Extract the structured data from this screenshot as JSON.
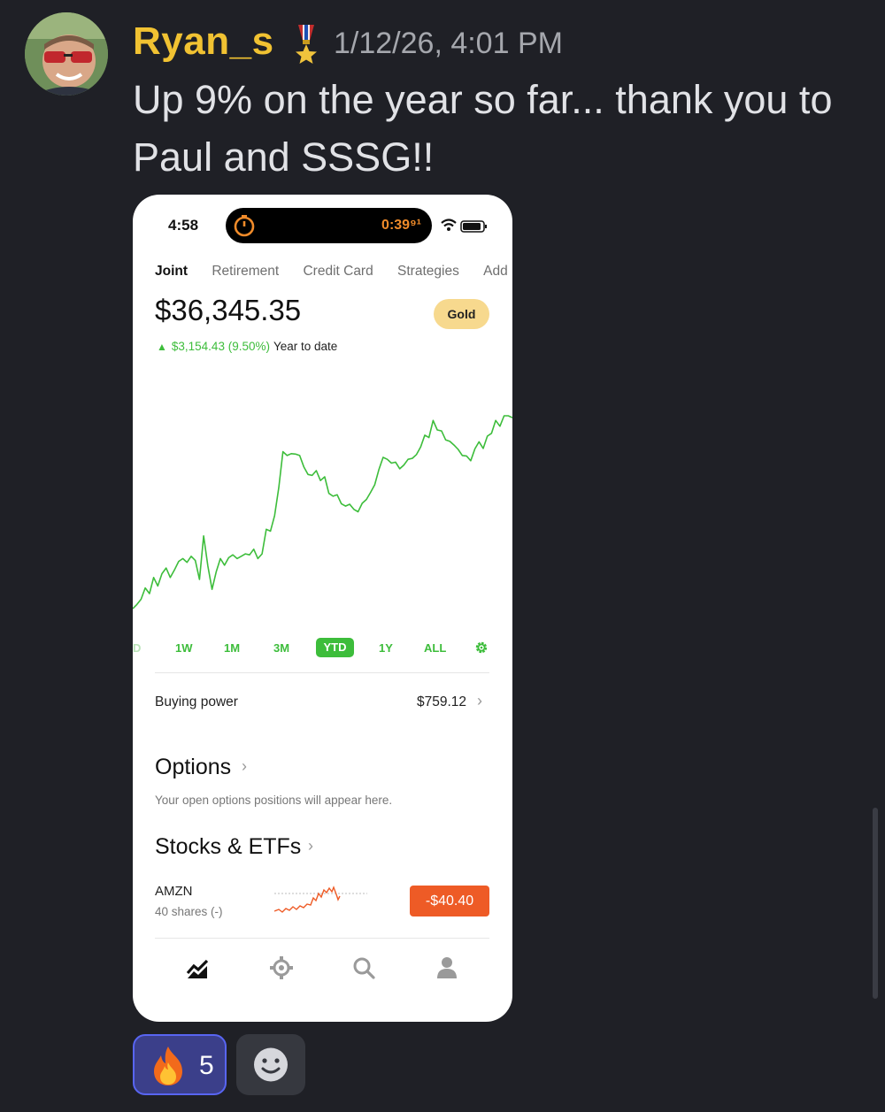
{
  "message": {
    "username": "Ryan_s",
    "timestamp": "1/12/26, 4:01 PM",
    "text": "Up 9% on the year so far... thank you to Paul and SSSG!!",
    "icons": {
      "avatar": "user-photo",
      "badge": "medal-icon"
    }
  },
  "phone": {
    "status_time": "4:58",
    "timer_text": "0:39⁹¹",
    "tabs": [
      "Joint",
      "Retirement",
      "Credit Card",
      "Strategies",
      "Add"
    ],
    "active_tab": "Joint",
    "balance": "$36,345.35",
    "gold_badge": "Gold",
    "change_value": "$3,154.43 (9.50%)",
    "change_period": "Year to date",
    "ranges": [
      "D",
      "1W",
      "1M",
      "3M",
      "YTD",
      "1Y",
      "ALL"
    ],
    "selected_range": "YTD",
    "buying_power_label": "Buying power",
    "buying_power_value": "$759.12",
    "options_title": "Options",
    "options_note": "Your open options positions will appear here.",
    "stocks_title": "Stocks & ETFs",
    "holding": {
      "ticker": "AMZN",
      "shares": "40 shares (-)",
      "price_change": "-$40.40"
    },
    "nav_icons": [
      "chart-icon",
      "crypto-icon",
      "search-icon",
      "profile-icon"
    ]
  },
  "reactions": {
    "emoji": "fire-icon",
    "count": "5"
  },
  "colors": {
    "background": "#1f2026",
    "username": "#f1c232",
    "gain_green": "#3dbd3b",
    "loss_orange": "#ee5b26",
    "gold": "#f7d98e",
    "reaction_bg": "#3b3f8a",
    "reaction_border": "#5865f2"
  },
  "chart_data": {
    "type": "line",
    "title": "",
    "xlabel": "",
    "ylabel": "",
    "y": [
      33191,
      33235,
      33290,
      33410,
      33350,
      33520,
      33430,
      33560,
      33620,
      33520,
      33600,
      33690,
      33720,
      33680,
      33745,
      33700,
      33500,
      33960,
      33640,
      33395,
      33580,
      33720,
      33650,
      33730,
      33760,
      33720,
      33745,
      33770,
      33760,
      33820,
      33720,
      33770,
      34030,
      34010,
      34175,
      34470,
      34850,
      34810,
      34830,
      34825,
      34810,
      34690,
      34610,
      34600,
      34650,
      34545,
      34585,
      34410,
      34380,
      34395,
      34300,
      34275,
      34295,
      34240,
      34215,
      34305,
      34345,
      34420,
      34500,
      34660,
      34790,
      34770,
      34730,
      34740,
      34670,
      34710,
      34770,
      34780,
      34820,
      34900,
      35025,
      35000,
      35180,
      35080,
      35070,
      34975,
      34960,
      34920,
      34875,
      34810,
      34805,
      34755,
      34880,
      34955,
      34885,
      35015,
      35045,
      35180,
      35120,
      35230,
      35230,
      35210
    ],
    "ylim": [
      33191,
      35230
    ],
    "grid": false,
    "legend": "none"
  }
}
